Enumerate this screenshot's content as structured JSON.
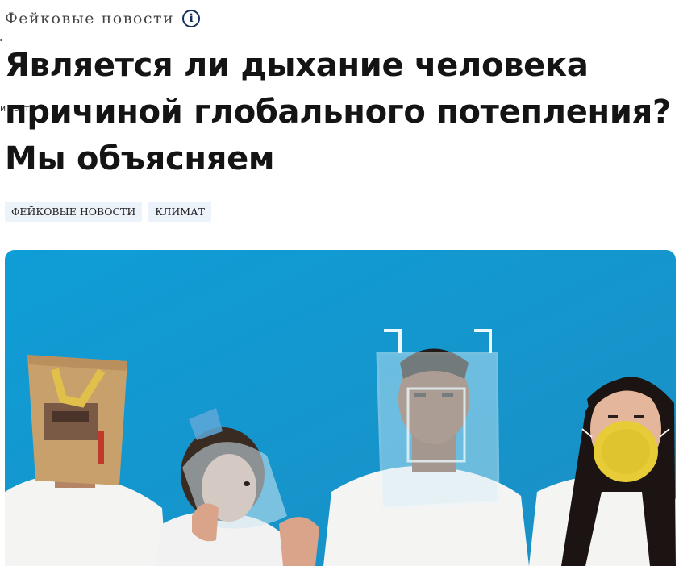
{
  "article": {
    "category": "Фейковые новости",
    "stray_text": "и кост",
    "headline": "Является ли дыхание человека причиной глобального потепления? Мы объясняем",
    "tags": [
      "ФЕЙКОВЫЕ НОВОСТИ",
      "КЛИМАТ"
    ],
    "hero_image": {
      "description_icon": "photo-of-four-people-with-bag-bottle-plastic-box-and-mask-on-heads",
      "background_color": "#139fd4"
    }
  },
  "icons": {
    "info": "info-circle-icon"
  }
}
